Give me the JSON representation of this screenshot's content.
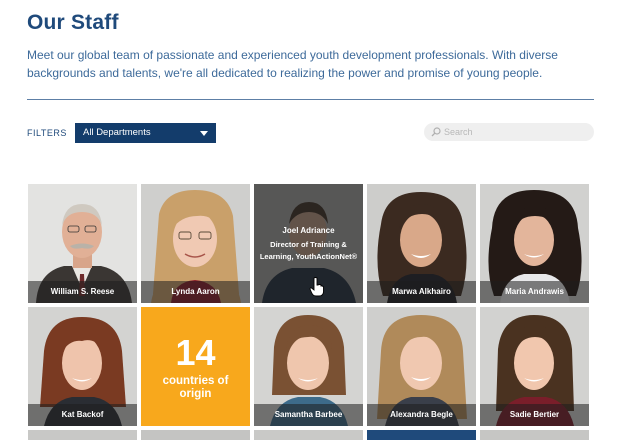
{
  "header": {
    "title": "Our Staff",
    "intro": "Meet our global team of passionate and experienced youth development professionals. With diverse backgrounds and talents, we're all dedicated to realizing the power and promise of young people."
  },
  "filters": {
    "label": "FILTERS",
    "department_selected": "All Departments",
    "search_placeholder": "Search"
  },
  "staff": [
    {
      "name": "William S. Reese"
    },
    {
      "name": "Lynda Aaron"
    },
    {
      "name": "Joel Adriance",
      "title": "Director of Training & Learning, YouthActionNet®",
      "hovered": true
    },
    {
      "name": "Marwa Alkhairo"
    },
    {
      "name": "Maria Andrawis"
    },
    {
      "name": "Kat Backof"
    },
    {
      "name": "Samantha Barbee"
    },
    {
      "name": "Alexandra Begle"
    },
    {
      "name": "Sadie Bertier"
    }
  ],
  "stat": {
    "number": "14",
    "label_line1": "countries of",
    "label_line2": "origin",
    "color": "#f8a81c"
  },
  "colors": {
    "brand_navy": "#133c6b",
    "title": "#1f4a7b"
  }
}
